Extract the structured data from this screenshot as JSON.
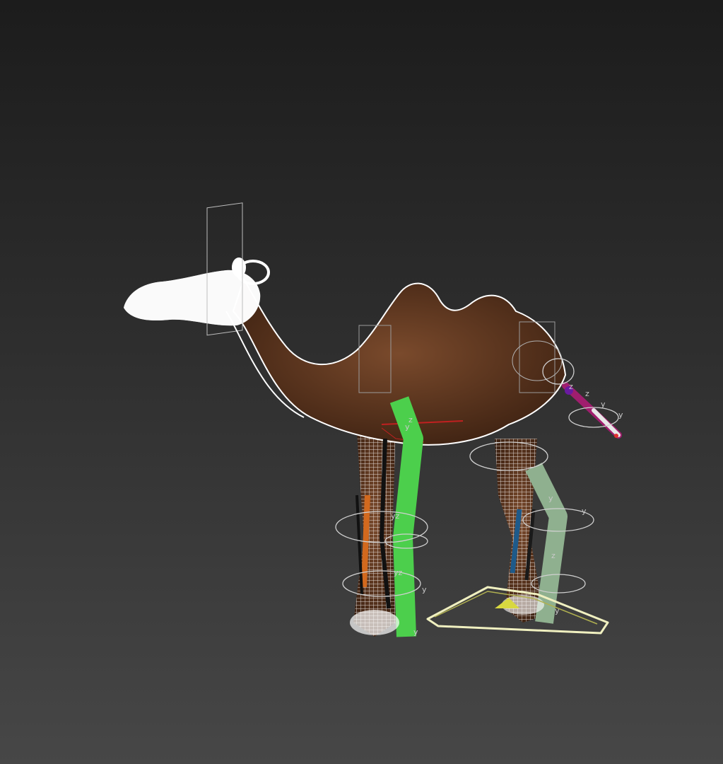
{
  "viewport": {
    "background_top": "#1c1c1c",
    "background_bottom": "#474747"
  },
  "model": {
    "mesh_fill": "#6b3b22",
    "wire_color": "#ffffff"
  },
  "rig": {
    "front_leg_bone_color": "#4ccf4c",
    "back_leg_bone_color": "#8fb08f",
    "front_leg_inner_color": "#d2691e",
    "back_leg_inner_color": "#1e5a8a",
    "tail_bone_color": "#a01e6e",
    "foot_control_color": "#f0f0c0",
    "axis_labels": [
      "y",
      "z",
      "yz",
      "yz",
      "z",
      "y",
      "y",
      "z",
      "y",
      "y",
      "y",
      "z",
      "y",
      "y"
    ]
  }
}
